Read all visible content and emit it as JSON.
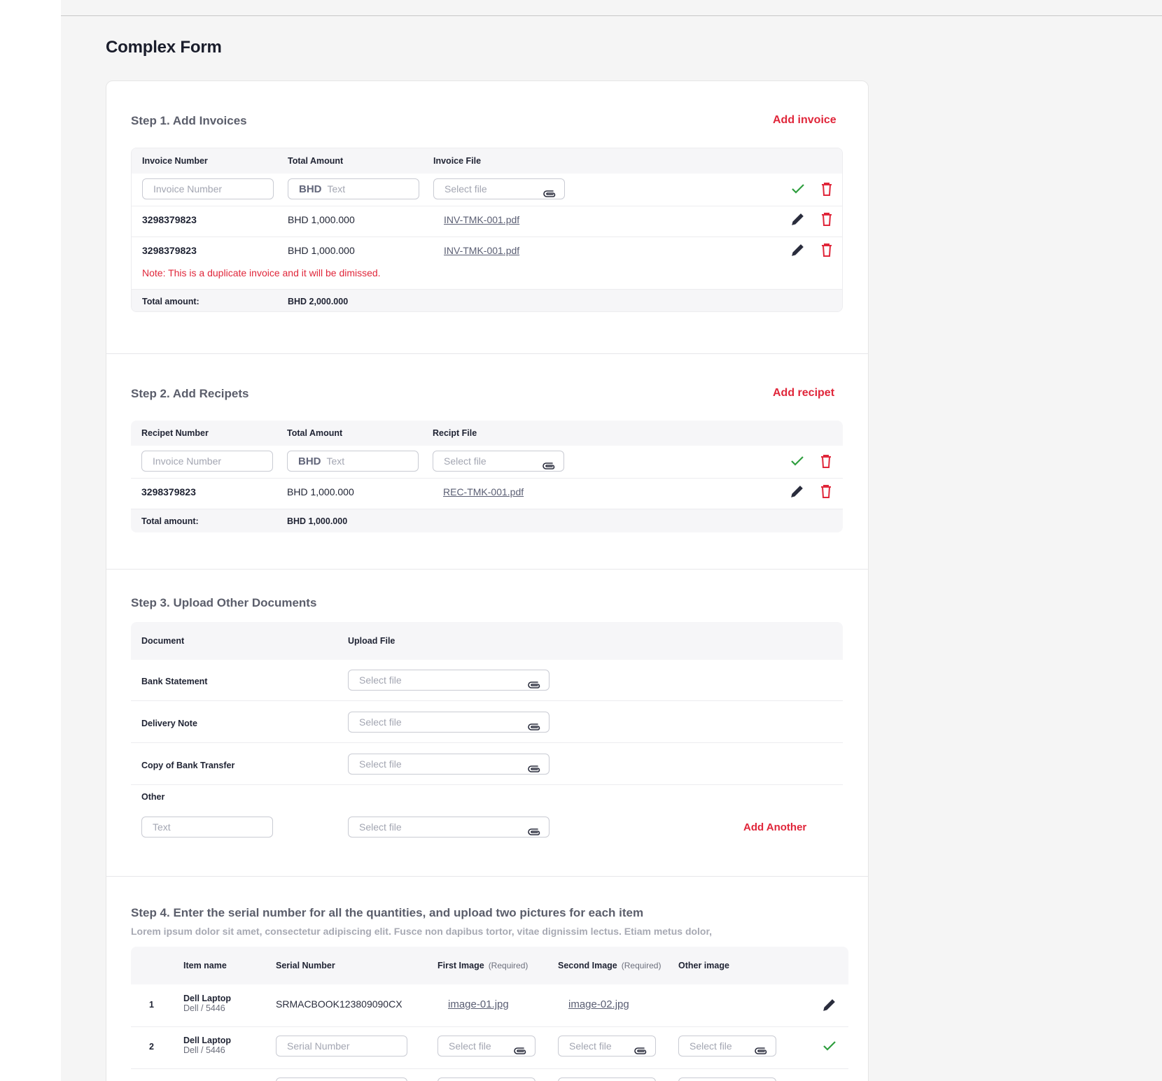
{
  "page": {
    "title": "Complex Form"
  },
  "icons": {
    "clip": "paperclip-icon",
    "check": "check-icon",
    "trash": "trash-icon",
    "edit": "pencil-icon"
  },
  "colors": {
    "accent": "#e0263a",
    "success": "#2e9e3e",
    "text": "#1f2333",
    "muted": "#a3a6b2"
  },
  "step1": {
    "title": "Step 1.  Add Invoices",
    "add_label": "Add invoice",
    "headers": {
      "number": "Invoice Number",
      "amount": "Total Amount",
      "file": "Invoice File"
    },
    "new_row": {
      "number_placeholder": "Invoice Number",
      "currency": "BHD",
      "amount_placeholder": "Text",
      "file_placeholder": "Select file"
    },
    "rows": [
      {
        "number": "3298379823",
        "amount": "BHD 1,000.000",
        "file": "INV-TMK-001.pdf"
      },
      {
        "number": "3298379823",
        "amount": "BHD 1,000.000",
        "file": "INV-TMK-001.pdf"
      }
    ],
    "duplicate_note": "Note: This is a duplicate invoice and it will be dimissed.",
    "total_label": "Total amount:",
    "total_value": "BHD 2,000.000"
  },
  "step2": {
    "title": "Step 2.  Add Recipets",
    "add_label": "Add recipet",
    "headers": {
      "number": "Recipet Number",
      "amount": "Total Amount",
      "file": "Recipt File"
    },
    "new_row": {
      "number_placeholder": "Invoice Number",
      "currency": "BHD",
      "amount_placeholder": "Text",
      "file_placeholder": "Select file"
    },
    "rows": [
      {
        "number": "3298379823",
        "amount": "BHD 1,000.000",
        "file": "REC-TMK-001.pdf"
      }
    ],
    "total_label": "Total amount:",
    "total_value": "BHD 1,000.000"
  },
  "step3": {
    "title": "Step 3. Upload Other Documents",
    "headers": {
      "document": "Document",
      "upload": "Upload File"
    },
    "rows": [
      {
        "label": "Bank Statement",
        "file_placeholder": "Select file"
      },
      {
        "label": "Delivery Note",
        "file_placeholder": "Select file"
      },
      {
        "label": "Copy of Bank Transfer",
        "file_placeholder": "Select file"
      }
    ],
    "other": {
      "label": "Other",
      "text_placeholder": "Text",
      "file_placeholder": "Select file",
      "add_label": "Add Another"
    }
  },
  "step4": {
    "title": "Step 4. Enter the serial number for all the quantities, and upload two pictures for each item",
    "subtitle": "Lorem ipsum dolor sit amet, consectetur adipiscing elit. Fusce non dapibus tortor, vitae dignissim lectus. Etiam metus dolor,",
    "headers": {
      "item": "Item name",
      "serial": "Serial Number",
      "first": "First Image",
      "second": "Second Image",
      "other": "Other image",
      "required": "(Required)"
    },
    "rows": [
      {
        "index": "1",
        "name": "Dell Laptop",
        "meta": "Dell / 5446",
        "serial": "SRMACBOOK123809090CX",
        "first": "image-01.jpg",
        "second": "image-02.jpg"
      },
      {
        "index": "2",
        "name": "Dell Laptop",
        "meta": "Dell / 5446",
        "serial_placeholder": "Serial Number",
        "file_placeholder": "Select file"
      }
    ]
  }
}
